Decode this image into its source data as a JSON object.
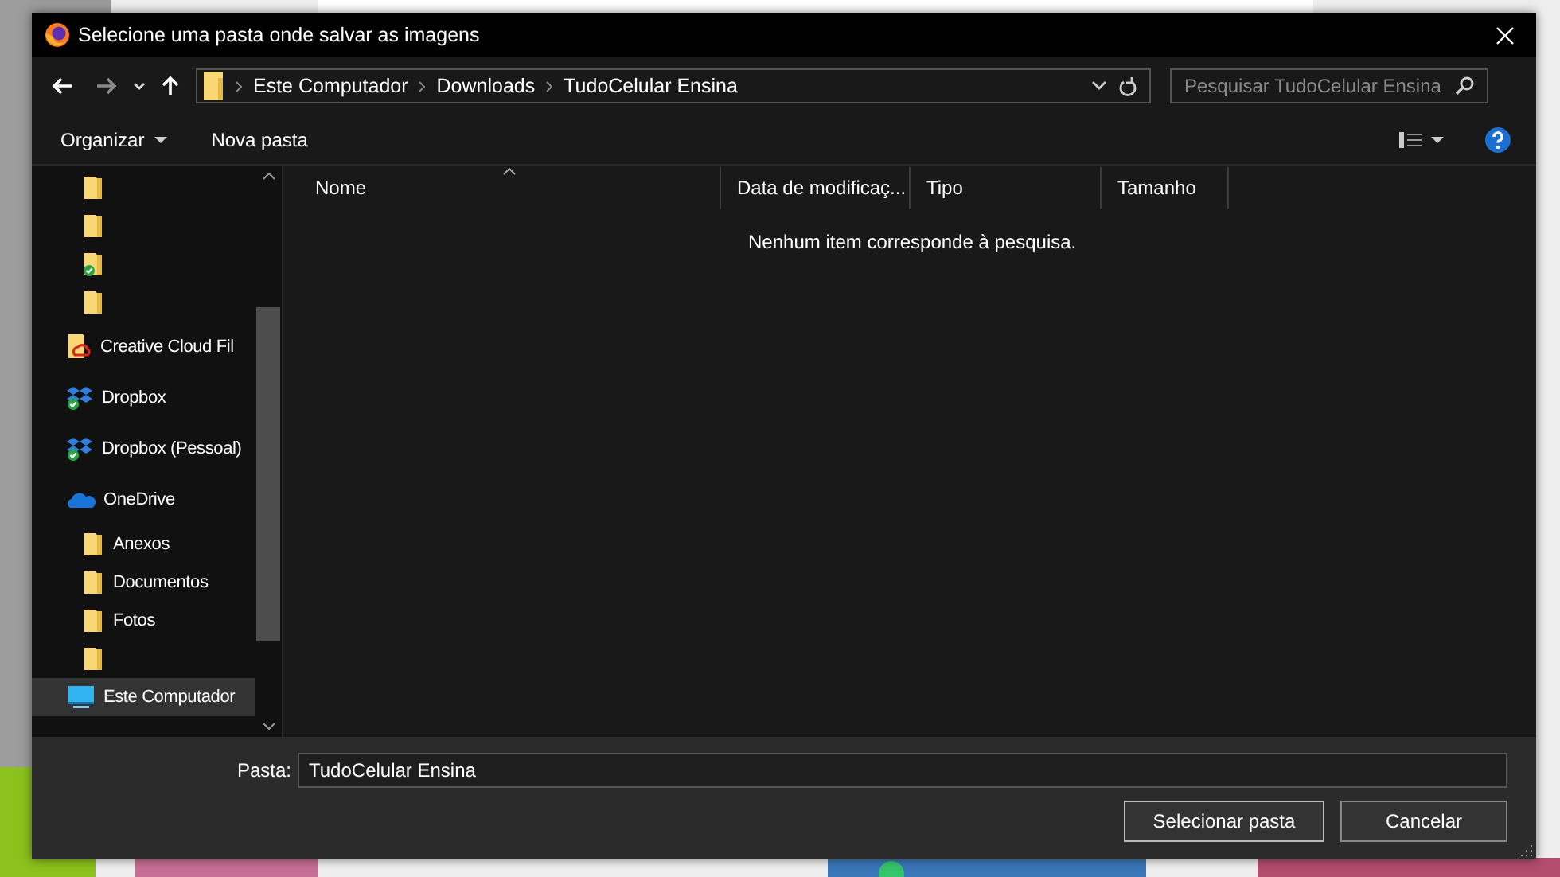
{
  "window": {
    "title": "Selecione uma pasta onde salvar as imagens"
  },
  "address_bar": {
    "crumbs": [
      "Este Computador",
      "Downloads",
      "TudoCelular Ensina"
    ]
  },
  "search": {
    "placeholder": "Pesquisar TudoCelular Ensina"
  },
  "toolbar": {
    "organize": "Organizar",
    "new_folder": "Nova pasta"
  },
  "sidebar": {
    "items": [
      {
        "children": [
          {
            "kind": "folder",
            "selected": false
          },
          {
            "kind": "folder",
            "selected": false
          },
          {
            "kind": "folder-synced",
            "selected": false
          },
          {
            "kind": "folder",
            "selected": false
          }
        ]
      },
      {
        "kind": "creative-cloud",
        "label": "Creative Cloud Fil",
        "selected": false
      },
      {
        "kind": "dropbox",
        "label": "Dropbox",
        "selected": false
      },
      {
        "kind": "dropbox",
        "label": "Dropbox (Pessoal)",
        "selected": false
      },
      {
        "kind": "onedrive",
        "label": "OneDrive",
        "selected": false,
        "children": [
          {
            "kind": "folder",
            "label": "Anexos",
            "selected": false
          },
          {
            "kind": "folder",
            "label": "Documentos",
            "selected": false
          },
          {
            "kind": "folder",
            "label": "Fotos",
            "selected": false
          },
          {
            "kind": "folder",
            "selected": false
          }
        ]
      },
      {
        "kind": "computer",
        "label": "Este Computador",
        "selected": true
      }
    ]
  },
  "table": {
    "columns": [
      {
        "label": "Nome",
        "sorted": true
      },
      {
        "label": "Data de modificaç...",
        "sorted": false
      },
      {
        "label": "Tipo",
        "sorted": false
      },
      {
        "label": "Tamanho",
        "sorted": false
      }
    ],
    "empty_message": "Nenhum item corresponde à pesquisa."
  },
  "folder_field": {
    "label": "Pasta:",
    "value": "TudoCelular Ensina"
  },
  "buttons": [
    "Selecionar pasta",
    "Cancelar"
  ]
}
